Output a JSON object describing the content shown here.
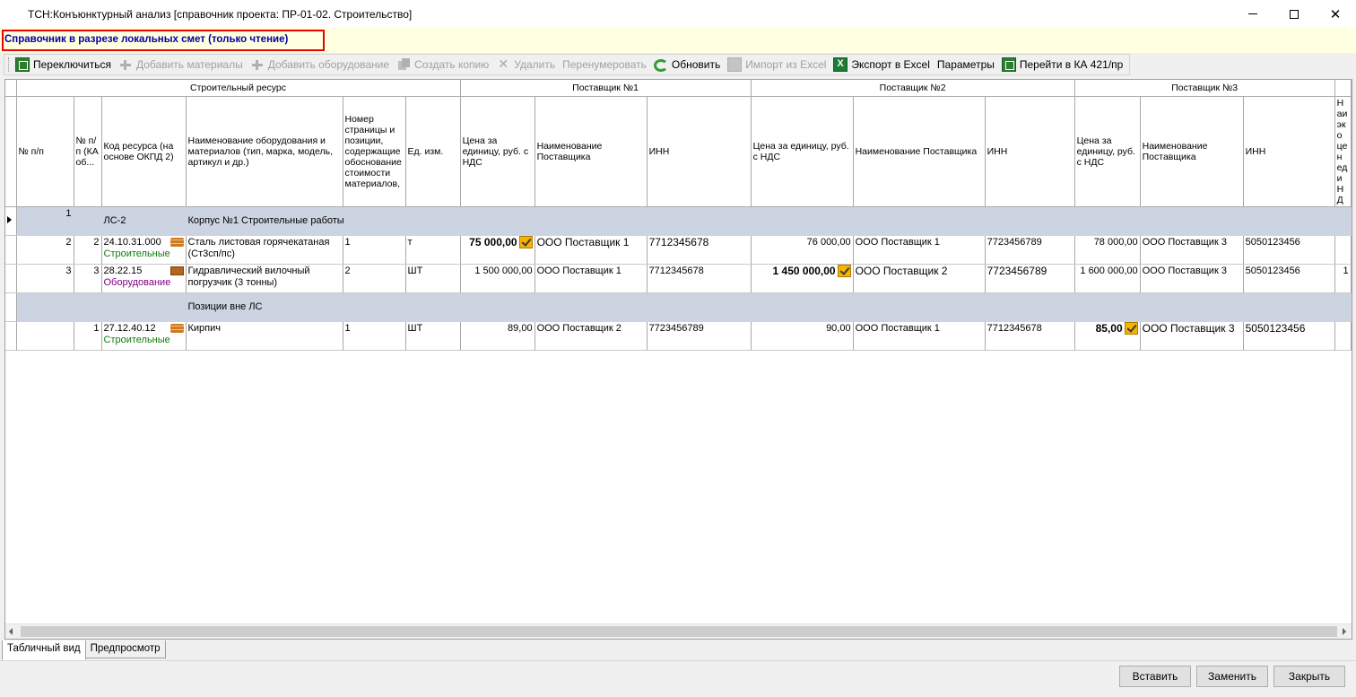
{
  "window": {
    "title": "ТСН:Конъюнктурный анализ [справочник проекта: ПР-01-02. Строительство]"
  },
  "banner": {
    "text": "Справочник в разрезе локальных смет (только чтение)",
    "border_color": "#ee0000",
    "text_color": "#0000a0"
  },
  "toolbar": {
    "switch": "Переключиться",
    "add_materials": "Добавить материалы",
    "add_equipment": "Добавить оборудование",
    "create_copy": "Создать копию",
    "delete": "Удалить",
    "renumber": "Перенумеровать",
    "refresh": "Обновить",
    "import_excel": "Импорт из Excel",
    "export_excel": "Экспорт в Excel",
    "parameters": "Параметры",
    "goto_ka": "Перейти в КА 421/пр"
  },
  "table": {
    "group_headers": {
      "resource": "Строительный ресурс",
      "supplier1": "Поставщик №1",
      "supplier2": "Поставщик №2",
      "supplier3": "Поставщик №3"
    },
    "columns": {
      "num": "№ п/п",
      "num_ka": "№ п/п (КА об...",
      "code": "Код ресурса (на основе ОКПД 2)",
      "name": "Наименование оборудования и материалов (тип, марка, модель, артикул и др.)",
      "page_num": "Номер страницы и позиции, содержащие обоснование стоимости материалов,",
      "unit": "Ед. изм.",
      "s1_price": "Цена за единицу, руб. с НДС",
      "s1_name": "Наименование Поставщика",
      "s1_inn": "ИНН",
      "s2_price": "Цена за единицу, руб. с НДС",
      "s2_name": "Наименование Поставщика",
      "s2_inn": "ИНН",
      "s3_price": "Цена за единицу, руб. с НДС",
      "s3_name": "Наименование Поставщика",
      "s3_inn": "ИНН",
      "extra": "Наи эко цен еди НД"
    },
    "section1": {
      "num": "1",
      "code": "ЛС-2",
      "name": "Корпус №1 Строительные работы"
    },
    "rows": [
      {
        "num": "2",
        "num_ka": "2",
        "code": "24.10.31.000",
        "category": "Строительные",
        "name": "Сталь листовая горячекатаная (Ст3сп/пс)",
        "page": "1",
        "unit": "т",
        "s1_price": "75 000,00",
        "s1_name": "ООО Поставщик 1",
        "s1_inn": "7712345678",
        "s2_price": "76 000,00",
        "s2_name": "ООО Поставщик 1",
        "s2_inn": "7723456789",
        "s3_price": "78 000,00",
        "s3_name": "ООО Поставщик 3",
        "s3_inn": "5050123456"
      },
      {
        "num": "3",
        "num_ka": "3",
        "code": "28.22.15",
        "category": "Оборудование",
        "name": "Гидравлический вилочный погрузчик (3 тонны)",
        "page": "2",
        "unit": "ШТ",
        "s1_price": "1 500 000,00",
        "s1_name": "ООО Поставщик 1",
        "s1_inn": "7712345678",
        "s2_price": "1 450 000,00",
        "s2_name": "ООО Поставщик 2",
        "s2_inn": "7723456789",
        "s3_price": "1 600 000,00",
        "s3_name": "ООО Поставщик 3",
        "s3_inn": "5050123456",
        "extra": "1"
      }
    ],
    "section2": {
      "name": "Позиции вне ЛС"
    },
    "rows2": [
      {
        "num_ka": "1",
        "code": "27.12.40.12",
        "category": "Строительные",
        "name": "Кирпич",
        "page": "1",
        "unit": "ШТ",
        "s1_price": "89,00",
        "s1_name": "ООО Поставщик 2",
        "s1_inn": "7723456789",
        "s2_price": "90,00",
        "s2_name": "ООО Поставщик 1",
        "s2_inn": "7712345678",
        "s3_price": "85,00",
        "s3_name": "ООО Поставщик 3",
        "s3_inn": "5050123456"
      }
    ]
  },
  "tabs": {
    "table_view": "Табличный вид",
    "preview": "Предпросмотр"
  },
  "buttons": {
    "insert": "Вставить",
    "replace": "Заменить",
    "close": "Закрыть"
  }
}
